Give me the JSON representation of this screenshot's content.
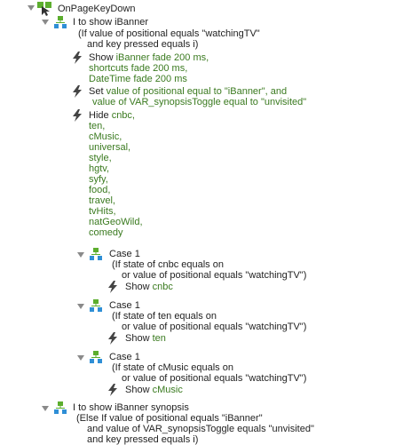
{
  "event": {
    "label": "OnPageKeyDown"
  },
  "case_show_ibanner": {
    "title": "I to show iBanner",
    "condition_line1": "(If value of positional equals \"watchingTV\"",
    "condition_line2": "and key pressed equals i)"
  },
  "action_show": {
    "verb": "Show",
    "line1": "iBanner fade 200 ms,",
    "line2": "shortcuts fade 200 ms,",
    "line3": "DateTime fade 200 ms"
  },
  "action_set": {
    "verb": "Set",
    "line1": "value of positional equal to \"iBanner\", and",
    "line2": "value of VAR_synopsisToggle equal to \"unvisited\""
  },
  "action_hide": {
    "verb": "Hide",
    "first": "cnbc,",
    "items": [
      "ten,",
      "cMusic,",
      "universal,",
      "style,",
      "hgtv,",
      "syfy,",
      "food,",
      "travel,",
      "tvHits,",
      "natGeoWild,",
      "comedy"
    ]
  },
  "sub_cases": [
    {
      "title": "Case 1",
      "cond1": "(If state of cnbc equals on",
      "cond2": "or value of positional equals \"watchingTV\")",
      "show_verb": "Show",
      "show_target": "cnbc"
    },
    {
      "title": "Case 1",
      "cond1": "(If state of ten equals on",
      "cond2": "or value of positional equals \"watchingTV\")",
      "show_verb": "Show",
      "show_target": "ten"
    },
    {
      "title": "Case 1",
      "cond1": "(If state of cMusic equals on",
      "cond2": "or value of positional equals \"watchingTV\")",
      "show_verb": "Show",
      "show_target": "cMusic"
    }
  ],
  "case_show_synopsis": {
    "title": "I to show iBanner synopsis",
    "line1": "(Else If value of positional equals \"iBanner\"",
    "line2": "and value of VAR_synopsisToggle equals \"unvisited\"",
    "line3": "and key pressed equals i)"
  },
  "colors": {
    "value_text": "#3a7a1f",
    "tree_icon_green": "#5cae2e",
    "tree_icon_blue": "#2f8fd6",
    "lightning_icon": "#444444"
  }
}
